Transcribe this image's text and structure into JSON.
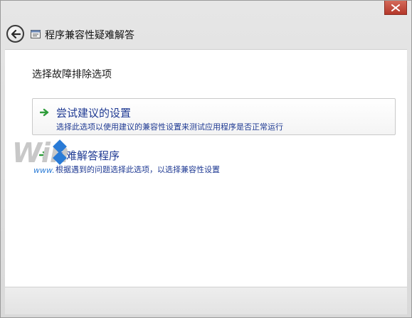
{
  "window": {
    "title": "程序兼容性疑难解答"
  },
  "icons": {
    "back": "back-arrow-icon",
    "app": "troubleshooter-app-icon",
    "close": "close-icon",
    "option_arrow": "green-arrow-icon"
  },
  "content": {
    "heading": "选择故障排除选项",
    "options": [
      {
        "title": "尝试建议的设置",
        "description": "选择此选项以使用建议的兼容性设置来测试应用程序是否正常运行"
      },
      {
        "title": "疑难解答程序",
        "description": "根据遇到的问题选择此选项，以选择兼容性设置"
      }
    ]
  },
  "watermark": {
    "logo_text": "Win",
    "url": "www."
  },
  "colors": {
    "link_blue": "#1f3a93",
    "arrow_green": "#2e9d3a",
    "close_red": "#c0392b"
  }
}
